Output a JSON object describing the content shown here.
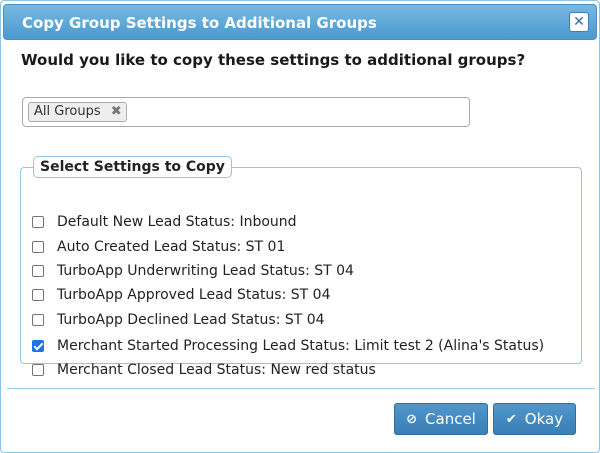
{
  "dialog": {
    "title": "Copy Group Settings to Additional Groups",
    "close_icon": "close-icon",
    "close_glyph": "✕"
  },
  "question": "Would you like to copy these settings to additional groups?",
  "groups_select": {
    "tags": [
      {
        "label": "All Groups",
        "remove_glyph": "✖"
      }
    ]
  },
  "settings": {
    "legend": "Select Settings to Copy",
    "options": [
      {
        "label": "Default New Lead Status: Inbound",
        "checked": false
      },
      {
        "label": "Auto Created Lead Status: ST 01",
        "checked": false
      },
      {
        "label": "TurboApp Underwriting Lead Status: ST 04",
        "checked": false
      },
      {
        "label": "TurboApp Approved Lead Status: ST 04",
        "checked": false
      },
      {
        "label": "TurboApp Declined Lead Status: ST 04",
        "checked": false
      },
      {
        "label": "Merchant Started Processing Lead Status: Limit test 2 (Alina's Status)",
        "checked": true
      },
      {
        "label": "Merchant Closed Lead Status: New red status",
        "checked": false
      }
    ]
  },
  "buttons": {
    "cancel": {
      "label": "Cancel",
      "icon": "cancel-icon",
      "glyph": "⊘"
    },
    "okay": {
      "label": "Okay",
      "icon": "checkmark-icon",
      "glyph": "✔"
    }
  },
  "colors": {
    "titlebar": "#4a9ad0",
    "accent": "#3a7fb6",
    "checkbox_checked": "#1a73e8"
  }
}
